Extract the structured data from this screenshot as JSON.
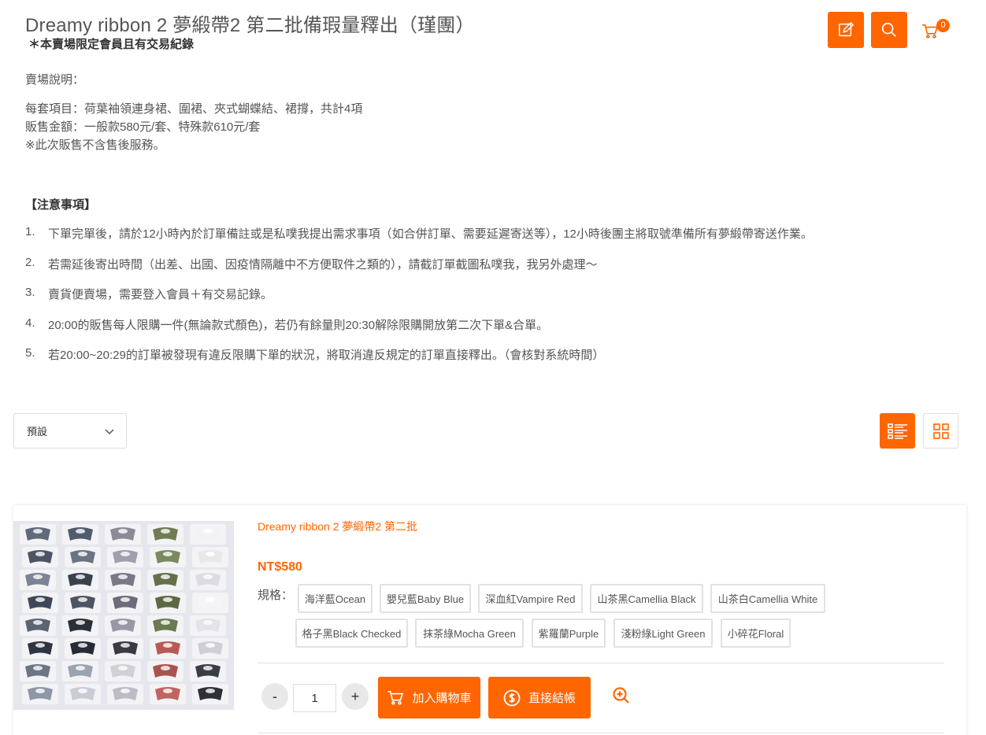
{
  "header": {
    "title": "Dreamy ribbon 2 夢緞帶2 第二批備瑕量釋出（瑾團）",
    "subtitle": "＊本賣場限定會員且有交易紀錄",
    "cart_count": "0",
    "accent_color": "#ff6600"
  },
  "description": {
    "heading": "賣場說明：",
    "lines": [
      "每套項目：荷葉袖領連身裙、圍裙、夾式蝴蝶結、裙撐，共計4項",
      "販售金額：一般款580元/套、特殊款610元/套",
      "※此次販售不含售後服務。"
    ]
  },
  "notice": {
    "heading": "【注意事項】",
    "items": [
      {
        "num": "1.",
        "text": "下單完單後，請於12小時內於訂單備註或是私噗我提出需求事項（如合併訂單、需要延遲寄送等），12小時後團主將取號準備所有夢緞帶寄送作業。"
      },
      {
        "num": "2.",
        "text": "若需延後寄出時間（出差、出國、因疫情隔離中不方便取件之類的），請截訂單截圖私噗我，我另外處理～"
      },
      {
        "num": "3.",
        "text": "賣貨便賣場，需要登入會員＋有交易記錄。"
      },
      {
        "num": "4.",
        "text": "20:00的販售每人限購一件(無論款式顏色)，若仍有餘量則20:30解除限購開放第二次下單&合單。"
      },
      {
        "num": "5.",
        "text": "若20:00~20:29的訂單被發現有違反限購下單的狀況，將取消違反規定的訂單直接釋出。（會核對系統時間）"
      }
    ]
  },
  "toolbar": {
    "sort_value": "預設"
  },
  "product": {
    "name": "Dreamy ribbon 2 夢緞帶2 第二批",
    "price": "NT$580",
    "spec_label": "規格：",
    "specs": [
      "海洋藍Ocean",
      "嬰兒藍Baby Blue",
      "深血紅Vampire Red",
      "山茶黑Camellia Black",
      "山茶白Camellia White",
      "格子黑Black Checked",
      "抹茶綠Mocha Green",
      "紫羅蘭Purple",
      "淺粉綠Light Green",
      "小碎花Floral"
    ],
    "quantity": "1",
    "minus_label": "-",
    "plus_label": "+",
    "add_to_cart_label": "加入購物車",
    "checkout_label": "直接結帳"
  }
}
